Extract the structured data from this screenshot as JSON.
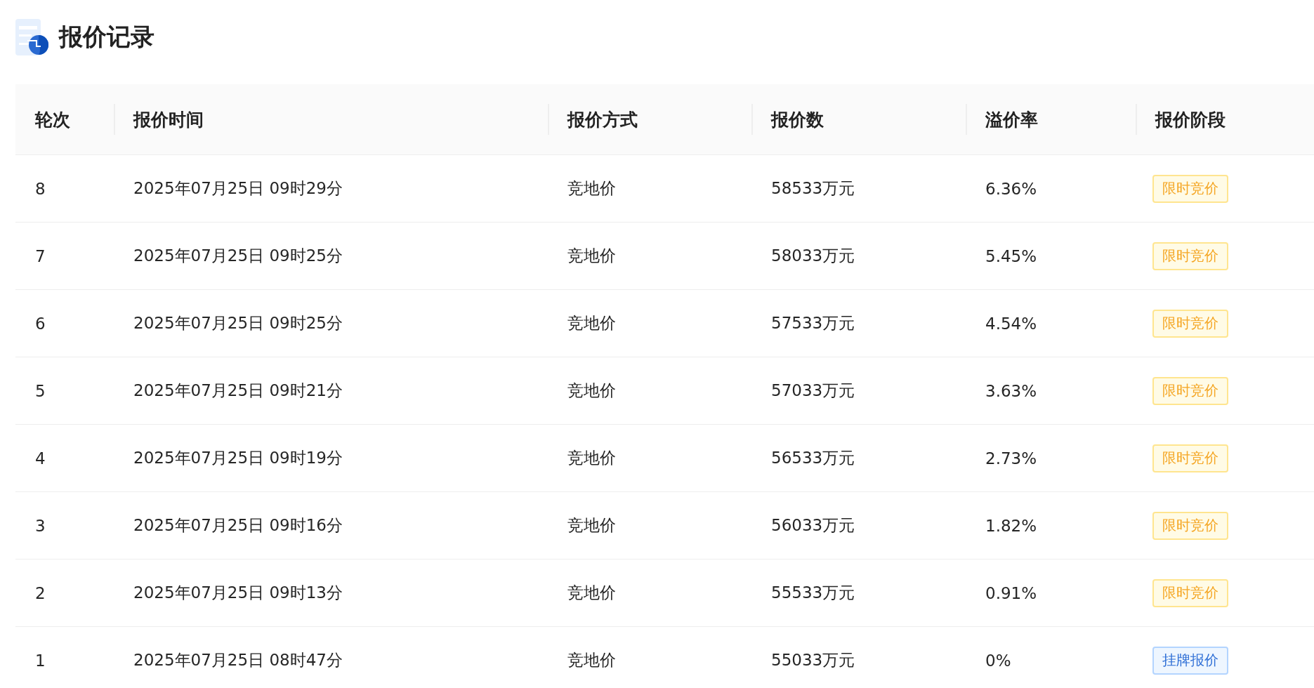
{
  "title": "报价记录",
  "table": {
    "columns": [
      "轮次",
      "报价时间",
      "报价方式",
      "报价数",
      "溢价率",
      "报价阶段"
    ],
    "rows": [
      {
        "round": "8",
        "time": "2025年07月25日 09时29分",
        "method": "竞地价",
        "amount": "58533万元",
        "premium": "6.36%",
        "stage": {
          "label": "限时竞价",
          "kind": "timed"
        }
      },
      {
        "round": "7",
        "time": "2025年07月25日 09时25分",
        "method": "竞地价",
        "amount": "58033万元",
        "premium": "5.45%",
        "stage": {
          "label": "限时竞价",
          "kind": "timed"
        }
      },
      {
        "round": "6",
        "time": "2025年07月25日 09时25分",
        "method": "竞地价",
        "amount": "57533万元",
        "premium": "4.54%",
        "stage": {
          "label": "限时竞价",
          "kind": "timed"
        }
      },
      {
        "round": "5",
        "time": "2025年07月25日 09时21分",
        "method": "竞地价",
        "amount": "57033万元",
        "premium": "3.63%",
        "stage": {
          "label": "限时竞价",
          "kind": "timed"
        }
      },
      {
        "round": "4",
        "time": "2025年07月25日 09时19分",
        "method": "竞地价",
        "amount": "56533万元",
        "premium": "2.73%",
        "stage": {
          "label": "限时竞价",
          "kind": "timed"
        }
      },
      {
        "round": "3",
        "time": "2025年07月25日 09时16分",
        "method": "竞地价",
        "amount": "56033万元",
        "premium": "1.82%",
        "stage": {
          "label": "限时竞价",
          "kind": "timed"
        }
      },
      {
        "round": "2",
        "time": "2025年07月25日 09时13分",
        "method": "竞地价",
        "amount": "55533万元",
        "premium": "0.91%",
        "stage": {
          "label": "限时竞价",
          "kind": "timed"
        }
      },
      {
        "round": "1",
        "time": "2025年07月25日 08时47分",
        "method": "竞地价",
        "amount": "55033万元",
        "premium": "0%",
        "stage": {
          "label": "挂牌报价",
          "kind": "listing"
        }
      }
    ]
  }
}
